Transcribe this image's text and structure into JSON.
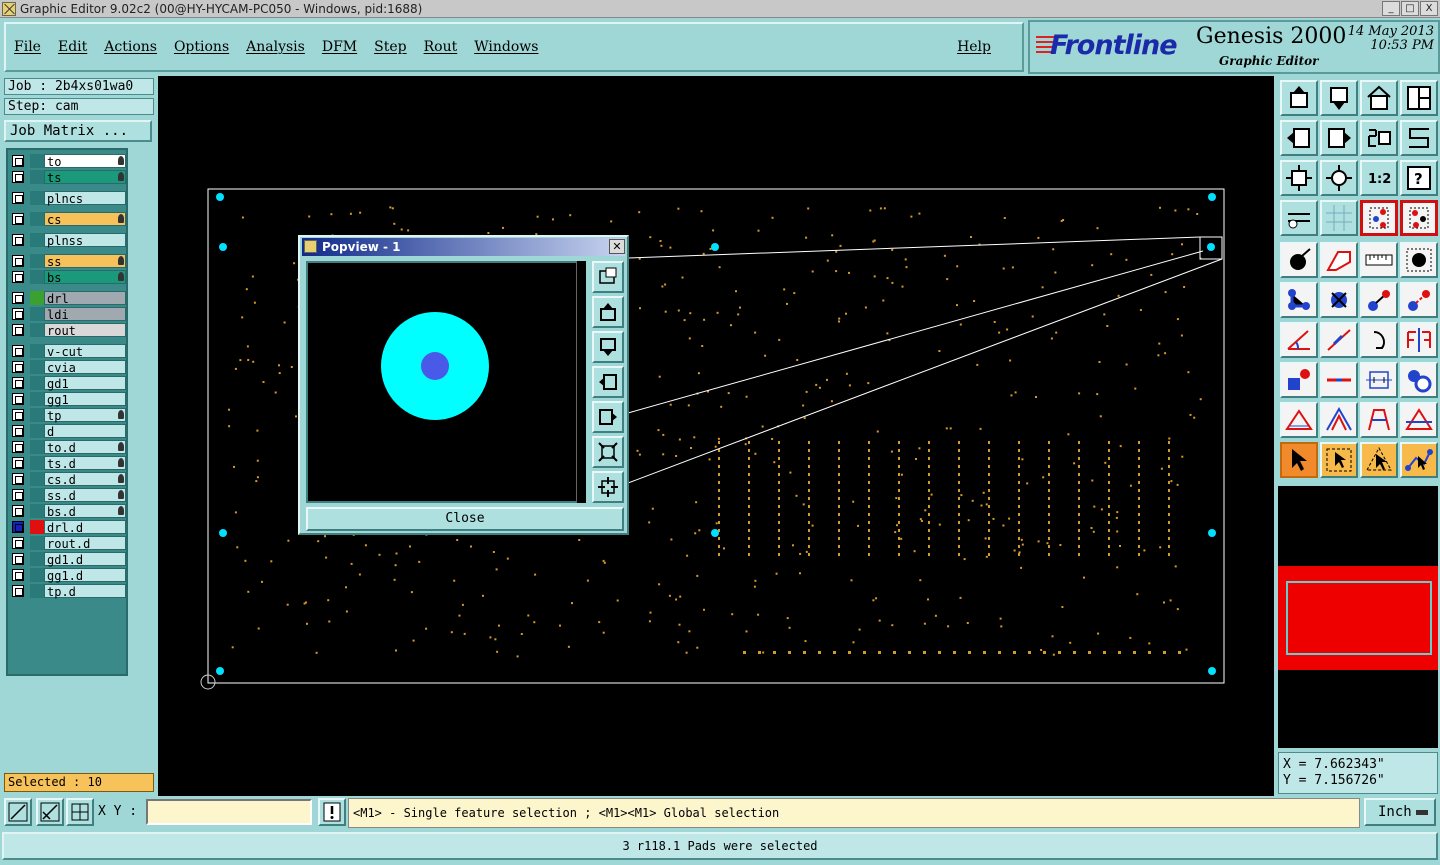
{
  "window": {
    "title": "Graphic Editor 9.02c2 (00@HY-HYCAM-PC050 - Windows, pid:1688)",
    "controls": [
      "_",
      "□",
      "X"
    ]
  },
  "menu": {
    "items": [
      "File",
      "Edit",
      "Actions",
      "Options",
      "Analysis",
      "DFM",
      "Step",
      "Rout",
      "Windows"
    ],
    "help": "Help"
  },
  "brand": {
    "logo": "Frontline",
    "product": "Genesis 2000",
    "subtitle": "Graphic Editor",
    "date": "14 May 2013",
    "time": "10:53 PM"
  },
  "job": {
    "job_line": "Job : 2b4xs01wa0",
    "step_line": "Step: cam",
    "matrix_button": "Job Matrix ..."
  },
  "layers": [
    {
      "name": "to",
      "color": "#ffffff",
      "flame": true
    },
    {
      "name": "ts",
      "color": "#1a9a7a",
      "flame": true
    },
    {
      "name": "plncs",
      "color": "#bfe7e7",
      "flame": false
    },
    {
      "name": "cs",
      "color": "#f7c25a",
      "flame": true
    },
    {
      "name": "plnss",
      "color": "#bfe7e7",
      "flame": false
    },
    {
      "name": "ss",
      "color": "#f7c25a",
      "flame": true
    },
    {
      "name": "bs",
      "color": "#1a9a7a",
      "flame": true
    },
    {
      "name": "drl",
      "color": "#a0a8b0",
      "chip": "#3aa030",
      "flame": false
    },
    {
      "name": "ldi",
      "color": "#a0a8b0",
      "flame": false
    },
    {
      "name": "rout",
      "color": "#d8d8d8",
      "flame": false
    },
    {
      "name": "v-cut",
      "color": "#bfe7e7",
      "flame": false
    },
    {
      "name": "cvia",
      "color": "#bfe7e7",
      "flame": false
    },
    {
      "name": "gd1",
      "color": "#bfe7e7",
      "flame": false
    },
    {
      "name": "gg1",
      "color": "#bfe7e7",
      "flame": false
    },
    {
      "name": "tp",
      "color": "#bfe7e7",
      "flame": true
    },
    {
      "name": "d",
      "color": "#bfe7e7",
      "flame": false
    },
    {
      "name": "to.d",
      "color": "#bfe7e7",
      "flame": true
    },
    {
      "name": "ts.d",
      "color": "#bfe7e7",
      "flame": true
    },
    {
      "name": "cs.d",
      "color": "#bfe7e7",
      "flame": true
    },
    {
      "name": "ss.d",
      "color": "#bfe7e7",
      "flame": true
    },
    {
      "name": "bs.d",
      "color": "#bfe7e7",
      "flame": true
    },
    {
      "name": "drl.d",
      "color": "#bfe7e7",
      "active": true,
      "flame": false
    },
    {
      "name": "rout.d",
      "color": "#bfe7e7",
      "flame": false
    },
    {
      "name": "gd1.d",
      "color": "#bfe7e7",
      "flame": false
    },
    {
      "name": "gg1.d",
      "color": "#bfe7e7",
      "flame": false
    },
    {
      "name": "tp.d",
      "color": "#bfe7e7",
      "flame": false
    }
  ],
  "selection": {
    "count_text": "Selected : 10"
  },
  "popview": {
    "title": "Popview - 1",
    "close_label": "Close",
    "pad_outer_color": "#00ffff",
    "pad_inner_color": "#4a5ae8"
  },
  "coords": {
    "x": "X = 7.662343\"",
    "y": "Y = 7.156726\""
  },
  "bottom": {
    "xy_label": "X Y :",
    "xy_value": "",
    "prompt": "<M1> - Single feature selection ; <M1><M1> Global selection",
    "unit": "Inch"
  },
  "status": {
    "message": "3 r118.1 Pads were selected"
  },
  "colors": {
    "panel": "#9fd6d6",
    "canvas": "#000000",
    "pad": "#d49a2a",
    "highlight": "#00e0ff"
  }
}
